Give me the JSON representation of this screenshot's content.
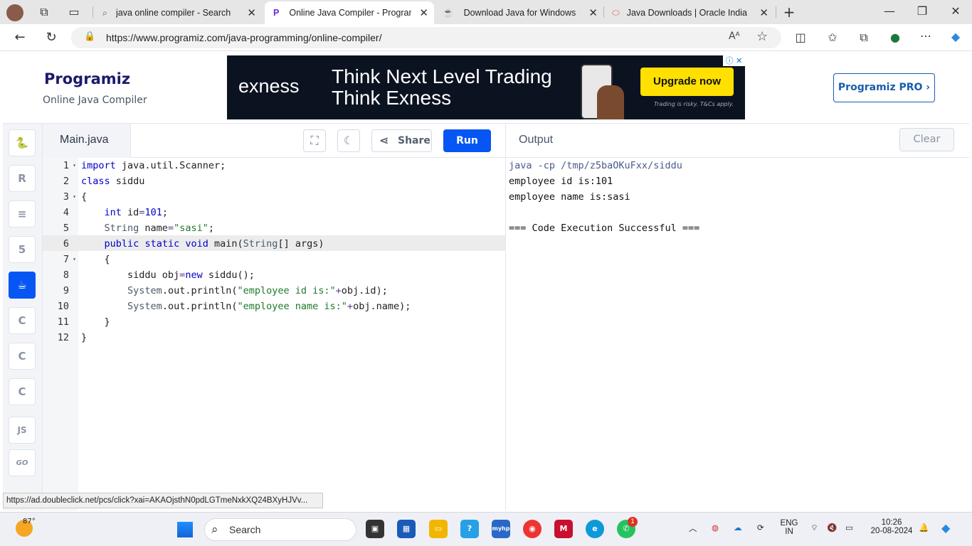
{
  "browser": {
    "tabs": [
      {
        "label": "java online compiler - Search",
        "active": false
      },
      {
        "label": "Online Java Compiler - Programiz",
        "active": true
      },
      {
        "label": "Download Java for Windows",
        "active": false
      },
      {
        "label": "Java Downloads | Oracle India",
        "active": false
      }
    ],
    "url": "https://www.programiz.com/java-programming/online-compiler/"
  },
  "header": {
    "logo": "Programiz",
    "subtitle": "Online Java Compiler",
    "pro_button": "Programiz PRO ›"
  },
  "ad": {
    "brand": "exness",
    "line1": "Think Next Level Trading",
    "line2": "Think Exness",
    "cta": "Upgrade now",
    "disclaimer": "Trading is risky. T&Cs apply."
  },
  "sidebar": {
    "items": [
      {
        "name": "python",
        "glyph": "🐍"
      },
      {
        "name": "r",
        "glyph": "R"
      },
      {
        "name": "sql",
        "glyph": "≡"
      },
      {
        "name": "html",
        "glyph": "5"
      },
      {
        "name": "java",
        "glyph": "☕",
        "active": true
      },
      {
        "name": "c",
        "glyph": "C"
      },
      {
        "name": "cpp",
        "glyph": "C"
      },
      {
        "name": "csharp",
        "glyph": "C"
      },
      {
        "name": "js",
        "glyph": "JS"
      },
      {
        "name": "go",
        "glyph": "GO"
      }
    ]
  },
  "editor": {
    "filename": "Main.java",
    "share_label": "Share",
    "run_label": "Run",
    "active_line": 6,
    "lines": [
      {
        "n": "1",
        "fold": true
      },
      {
        "n": "2",
        "fold": false
      },
      {
        "n": "3",
        "fold": true
      },
      {
        "n": "4",
        "fold": false
      },
      {
        "n": "5",
        "fold": false
      },
      {
        "n": "6",
        "fold": false
      },
      {
        "n": "7",
        "fold": true
      },
      {
        "n": "8",
        "fold": false
      },
      {
        "n": "9",
        "fold": false
      },
      {
        "n": "10",
        "fold": false
      },
      {
        "n": "11",
        "fold": false
      },
      {
        "n": "12",
        "fold": false
      }
    ],
    "code": [
      "import java.util.Scanner;",
      "class siddu",
      "{",
      "    int id=101;",
      "    String name=\"sasi\";",
      "    public static void main(String[] args)",
      "    {",
      "        siddu obj=new siddu();",
      "        System.out.println(\"employee id is:\"+obj.id);",
      "        System.out.println(\"employee name is:\"+obj.name);",
      "    }",
      "}"
    ]
  },
  "output": {
    "title": "Output",
    "clear_label": "Clear",
    "lines": [
      "java -cp /tmp/z5baOKuFxx/siddu",
      "employee id is:101",
      "employee name is:sasi",
      "",
      "=== Code Execution Successful ==="
    ]
  },
  "status_url": "https://ad.doubleclick.net/pcs/click?xai=AKAOjsthN0pdLGTmeNxkXQ24BXyHJVv...",
  "taskbar": {
    "weather": "87°",
    "search_label": "Search",
    "whatsapp_badge": "1",
    "lang": "ENG",
    "region": "IN",
    "time": "10:26",
    "date": "20-08-2024"
  },
  "colors": {
    "run_button": "#0556f3",
    "accent": "#0556f3"
  }
}
